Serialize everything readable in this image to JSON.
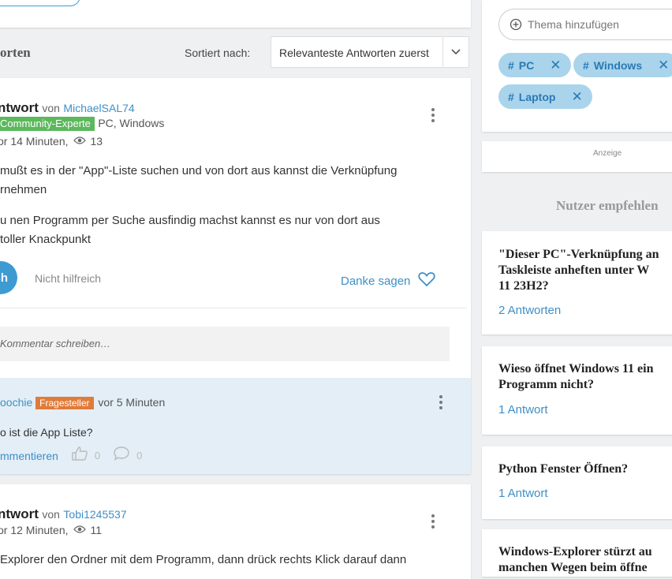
{
  "sort": {
    "label": "Sortiert nach:",
    "value": "Relevanteste Antworten zuerst"
  },
  "answers_heading": "orten",
  "answer1": {
    "heading": "ntwort",
    "von": "von",
    "user": "MichaelSAL74",
    "badge": "Community-Experte",
    "topics": "PC, Windows",
    "time": "or 14 Minuten,",
    "views": "13",
    "para1_line1": "mußt es in der \"App\"-Liste suchen und von dort aus kannst die Verknüpfung",
    "para1_line2": "rnehmen",
    "para2_line1": "u nen Programm per Suche ausfindig machst kannst es nur von dort aus",
    "para2_line2": "toller Knackpunkt",
    "helpful_label": "ch",
    "not_helpful": "Nicht hilfreich",
    "thanks": "Danke sagen",
    "comment_placeholder": "Kommentar schreiben…"
  },
  "reply": {
    "user": "oochie",
    "badge": "Fragesteller",
    "time": "vor 5 Minuten",
    "text": "o ist die App Liste?",
    "comment_link": "mmentieren",
    "likes": "0",
    "comments": "0"
  },
  "answer2": {
    "heading": "ntwort",
    "von": "von",
    "user": "Tobi1245537",
    "time": "or 12 Minuten,",
    "views": "11",
    "text": "Explorer den Ordner mit dem Programm, dann drück rechts Klick darauf dann"
  },
  "topics": {
    "placeholder": "Thema hinzufügen",
    "tags": [
      "PC",
      "Windows",
      "Laptop"
    ]
  },
  "ad_label": "Anzeige",
  "recommend_title": "Nutzer empfehlen",
  "questions": [
    {
      "title": "\"Dieser PC\"-Verknüpfung an\nTaskleiste anheften unter W\n11 23H2?",
      "answers": "2 Antworten"
    },
    {
      "title": "Wieso öffnet Windows 11 ein\nProgramm nicht?",
      "answers": "1 Antwort"
    },
    {
      "title": "Python Fenster Öffnen?",
      "answers": "1 Antwort"
    },
    {
      "title": "Windows-Explorer stürzt au\nmanchen Wegen beim öffne",
      "answers": ""
    }
  ],
  "colors": {
    "accent": "#3e9bd1",
    "expert_badge": "#5cb85c",
    "asker_badge": "#e07b39",
    "tag_bg": "#a9d4ec"
  }
}
